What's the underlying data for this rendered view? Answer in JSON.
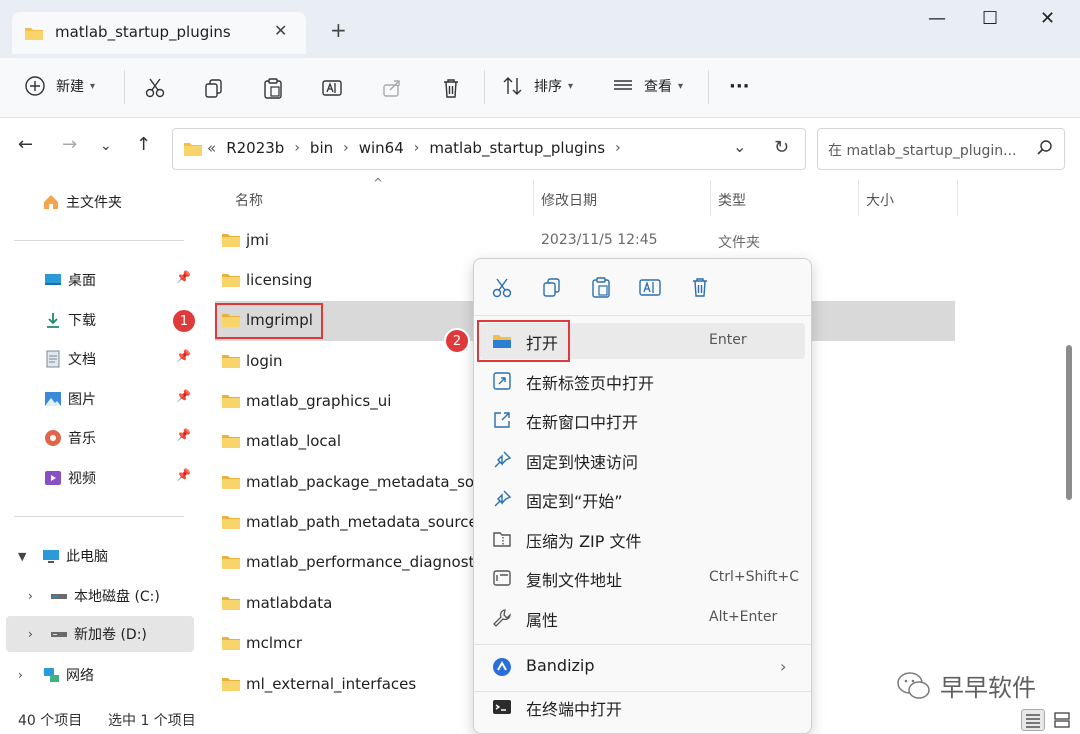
{
  "tab": {
    "title": "matlab_startup_plugins",
    "close": "✕",
    "new": "+"
  },
  "window": {
    "minimize": "—",
    "maximize": "☐",
    "close": "✕"
  },
  "toolbar": {
    "new_label": "新建",
    "sort_label": "排序",
    "view_label": "查看",
    "more": "···"
  },
  "address": {
    "overflow": "«",
    "crumbs": [
      "R2023b",
      "bin",
      "win64",
      "matlab_startup_plugins"
    ],
    "sep": "›"
  },
  "search": {
    "placeholder": "在 matlab_startup_plugin..."
  },
  "sidebar": {
    "home": "主文件夹",
    "quick": [
      {
        "label": "桌面"
      },
      {
        "label": "下载"
      },
      {
        "label": "文档"
      },
      {
        "label": "图片"
      },
      {
        "label": "音乐"
      },
      {
        "label": "视频"
      }
    ],
    "this_pc": "此电脑",
    "drive_c": "本地磁盘 (C:)",
    "drive_d": "新加卷 (D:)",
    "network": "网络"
  },
  "columns": {
    "name": "名称",
    "date": "修改日期",
    "type": "类型",
    "size": "大小"
  },
  "files": [
    {
      "name": "jmi",
      "date": "2023/11/5 12:45",
      "type": "文件夹"
    },
    {
      "name": "licensing",
      "date": "",
      "type": ""
    },
    {
      "name": "lmgrimpl",
      "date": "",
      "type": ""
    },
    {
      "name": "login",
      "date": "",
      "type": ""
    },
    {
      "name": "matlab_graphics_ui",
      "date": "",
      "type": ""
    },
    {
      "name": "matlab_local",
      "date": "",
      "type": ""
    },
    {
      "name": "matlab_package_metadata_sour",
      "date": "",
      "type": ""
    },
    {
      "name": "matlab_path_metadata_source",
      "date": "",
      "type": ""
    },
    {
      "name": "matlab_performance_diagnostic",
      "date": "",
      "type": ""
    },
    {
      "name": "matlabdata",
      "date": "",
      "type": ""
    },
    {
      "name": "mclmcr",
      "date": "",
      "type": ""
    },
    {
      "name": "ml_external_interfaces",
      "date": "",
      "type": ""
    }
  ],
  "badges": {
    "one": "1",
    "two": "2"
  },
  "context_menu": {
    "items": [
      {
        "label": "打开",
        "shortcut": "Enter"
      },
      {
        "label": "在新标签页中打开",
        "shortcut": ""
      },
      {
        "label": "在新窗口中打开",
        "shortcut": ""
      },
      {
        "label": "固定到快速访问",
        "shortcut": ""
      },
      {
        "label": "固定到“开始”",
        "shortcut": ""
      },
      {
        "label": "压缩为 ZIP 文件",
        "shortcut": ""
      },
      {
        "label": "复制文件地址",
        "shortcut": "Ctrl+Shift+C"
      },
      {
        "label": "属性",
        "shortcut": "Alt+Enter"
      }
    ],
    "bandizip": "Bandizip",
    "terminal": "在终端中打开",
    "chevron": "›"
  },
  "status": {
    "count": "40 个项目",
    "selected": "选中 1 个项目"
  },
  "watermark": "早早软件",
  "colors": {
    "accent": "#0067c0",
    "folder": "#f2c04a",
    "highlight": "#e0393b"
  }
}
